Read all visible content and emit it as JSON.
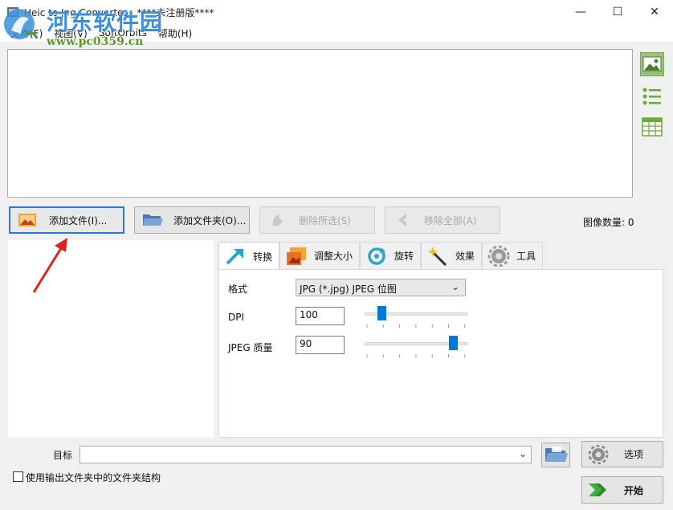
{
  "window": {
    "title": "Heic to Jpg Converter - ****未注册版****",
    "minimize_glyph": "—",
    "maximize_glyph": "☐",
    "close_glyph": "✕"
  },
  "watermark": {
    "text": "河东软件园",
    "url": "www.pc0359.cn"
  },
  "menu": [
    "文件(F)",
    "视图(V)",
    "SoftOrbits",
    "帮助(H)"
  ],
  "toolbar": {
    "add_files": "添加文件(I)...",
    "add_folder": "添加文件夹(O)...",
    "remove_selected": "删除所选(S)",
    "remove_all": "移除全部(A)"
  },
  "status": {
    "image_count": "图像数量: 0"
  },
  "view_icons": [
    "thumbnail-view-icon",
    "list-view-icon",
    "table-view-icon"
  ],
  "tabs": [
    {
      "label": "转换",
      "icon": "convert-arrow-icon",
      "active": true
    },
    {
      "label": "调整大小",
      "icon": "resize-icon",
      "active": false
    },
    {
      "label": "旋转",
      "icon": "rotate-icon",
      "active": false
    },
    {
      "label": "效果",
      "icon": "magic-wand-icon",
      "active": false
    },
    {
      "label": "工具",
      "icon": "gear-icon",
      "active": false
    }
  ],
  "convert": {
    "format_label": "格式",
    "format_value": "JPG (*.jpg) JPEG 位图",
    "dpi_label": "DPI",
    "dpi_value": "100",
    "dpi_slider_fraction": 0.14,
    "quality_label": "JPEG 质量",
    "quality_value": "90",
    "quality_slider_fraction": 0.9
  },
  "output": {
    "target_label": "目标",
    "target_value": "",
    "options_label": "选项",
    "start_label": "开始",
    "keep_structure_label": "使用输出文件夹中的文件夹结构",
    "keep_structure_checked": false
  },
  "colors": {
    "accent_blue": "#0078d7",
    "focus_border": "#2a7ad5",
    "watermark_blue": "#3a8fd8",
    "watermark_green": "#5a9a2a",
    "arrow_red": "#d9251c"
  }
}
